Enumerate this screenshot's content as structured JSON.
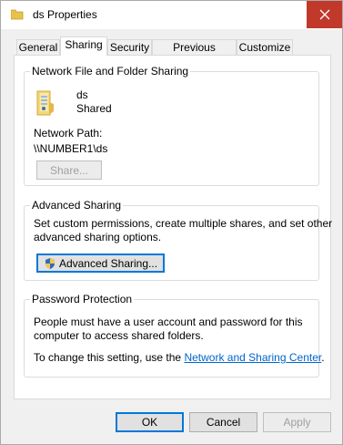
{
  "window": {
    "title": "ds Properties",
    "icon": "folder-icon",
    "close_icon": "close-icon"
  },
  "tabs": [
    {
      "label": "General",
      "active": false
    },
    {
      "label": "Sharing",
      "active": true
    },
    {
      "label": "Security",
      "active": false
    },
    {
      "label": "Previous Versions",
      "active": false
    },
    {
      "label": "Customize",
      "active": false
    }
  ],
  "network_sharing": {
    "group_label": "Network File and Folder Sharing",
    "folder_name": "ds",
    "status": "Shared",
    "path_label": "Network Path:",
    "path_value": "\\\\NUMBER1\\ds",
    "share_button": "Share..."
  },
  "advanced_sharing": {
    "group_label": "Advanced Sharing",
    "description_line1": "Set custom permissions, create multiple shares, and set other",
    "description_line2": "advanced sharing options.",
    "button_label": "Advanced Sharing..."
  },
  "password_protection": {
    "group_label": "Password Protection",
    "description_line1": "People must have a user account and password for this",
    "description_line2": "computer to access shared folders.",
    "change_prefix": "To change this setting, use the ",
    "link_text": "Network and Sharing Center",
    "change_suffix": "."
  },
  "footer": {
    "ok": "OK",
    "cancel": "Cancel",
    "apply": "Apply"
  },
  "colors": {
    "close_button": "#c0392b",
    "link": "#0066cc",
    "focus": "#0078d7"
  }
}
